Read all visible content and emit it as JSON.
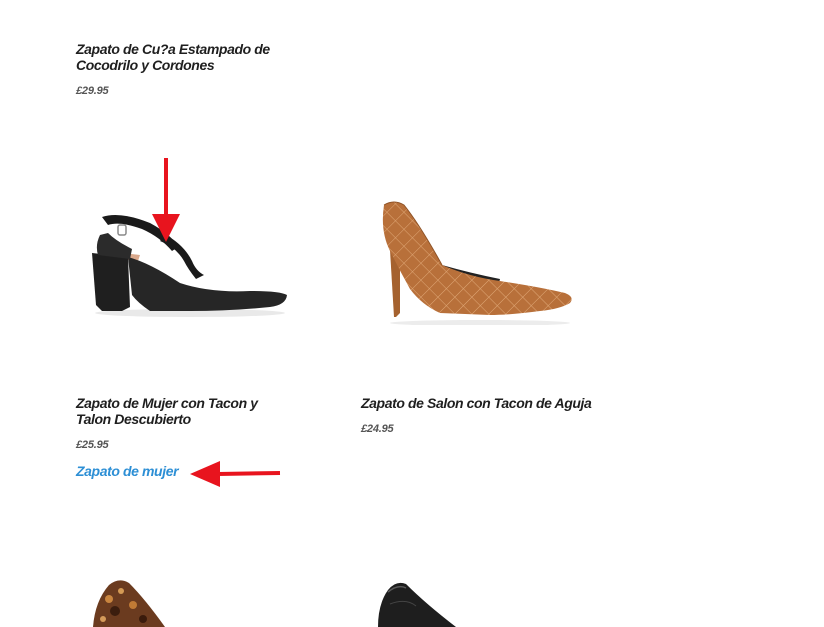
{
  "products": [
    {
      "name": "Zapato de Cu?a Estampado de Cocodrilo y Cordones",
      "price": "£29.95"
    },
    {
      "name": "Zapato de Mujer con Tacon y Talon Descubierto",
      "price": "£25.95",
      "category_link": "Zapato de mujer",
      "image_icon": "black-slingback-shoe-icon"
    },
    {
      "name": "Zapato de Salon con Tacon de Aguja",
      "price": "£24.95",
      "image_icon": "tan-quilted-stiletto-icon"
    },
    {
      "image_icon": "tortoiseshell-heel-icon"
    },
    {
      "image_icon": "black-leather-pump-icon"
    }
  ],
  "colors": {
    "link": "#2d8fd5",
    "annotation_arrow": "#e8141e",
    "title": "#1f1f1f",
    "price": "#555555"
  }
}
